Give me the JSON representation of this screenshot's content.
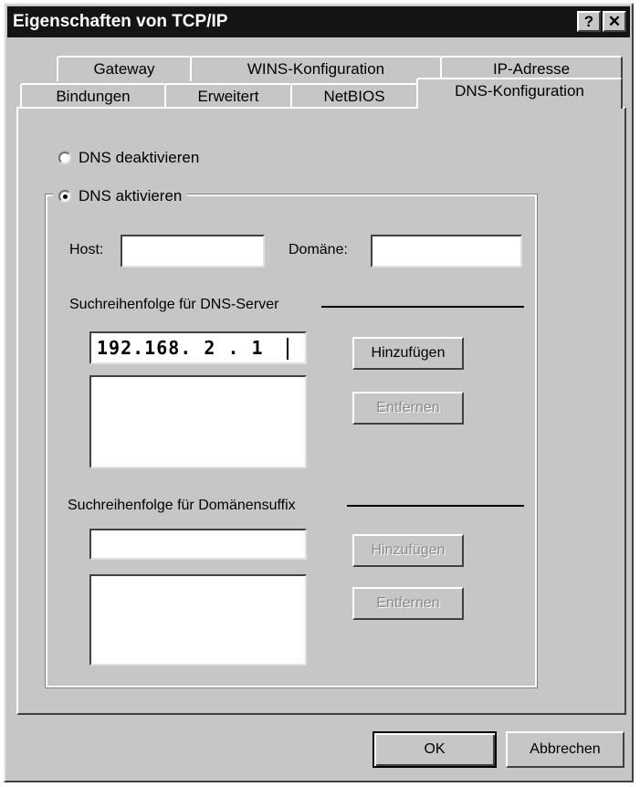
{
  "window": {
    "title": "Eigenschaften von TCP/IP",
    "help_button": "?",
    "close_button": "✕"
  },
  "tabs": {
    "back_row": [
      "Gateway",
      "WINS-Konfiguration",
      "IP-Adresse"
    ],
    "front_row": [
      "Bindungen",
      "Erweitert",
      "NetBIOS",
      "DNS-Konfiguration"
    ],
    "active": "DNS-Konfiguration"
  },
  "dns": {
    "disable_label": "DNS deaktivieren",
    "enable_label": "DNS aktivieren",
    "selected": "enable",
    "host_label": "Host:",
    "host_value": "",
    "domain_label": "Domäne:",
    "domain_value": "",
    "server_order_label": "Suchreihenfolge für DNS-Server",
    "server_input_value": "192.168. 2 . 1",
    "server_add_button": "Hinzufügen",
    "server_remove_button": "Entfernen",
    "suffix_order_label": "Suchreihenfolge für Domänensuffix",
    "suffix_input_value": "",
    "suffix_add_button": "Hinzufügen",
    "suffix_remove_button": "Entfernen"
  },
  "footer": {
    "ok_button": "OK",
    "cancel_button": "Abbrechen"
  }
}
